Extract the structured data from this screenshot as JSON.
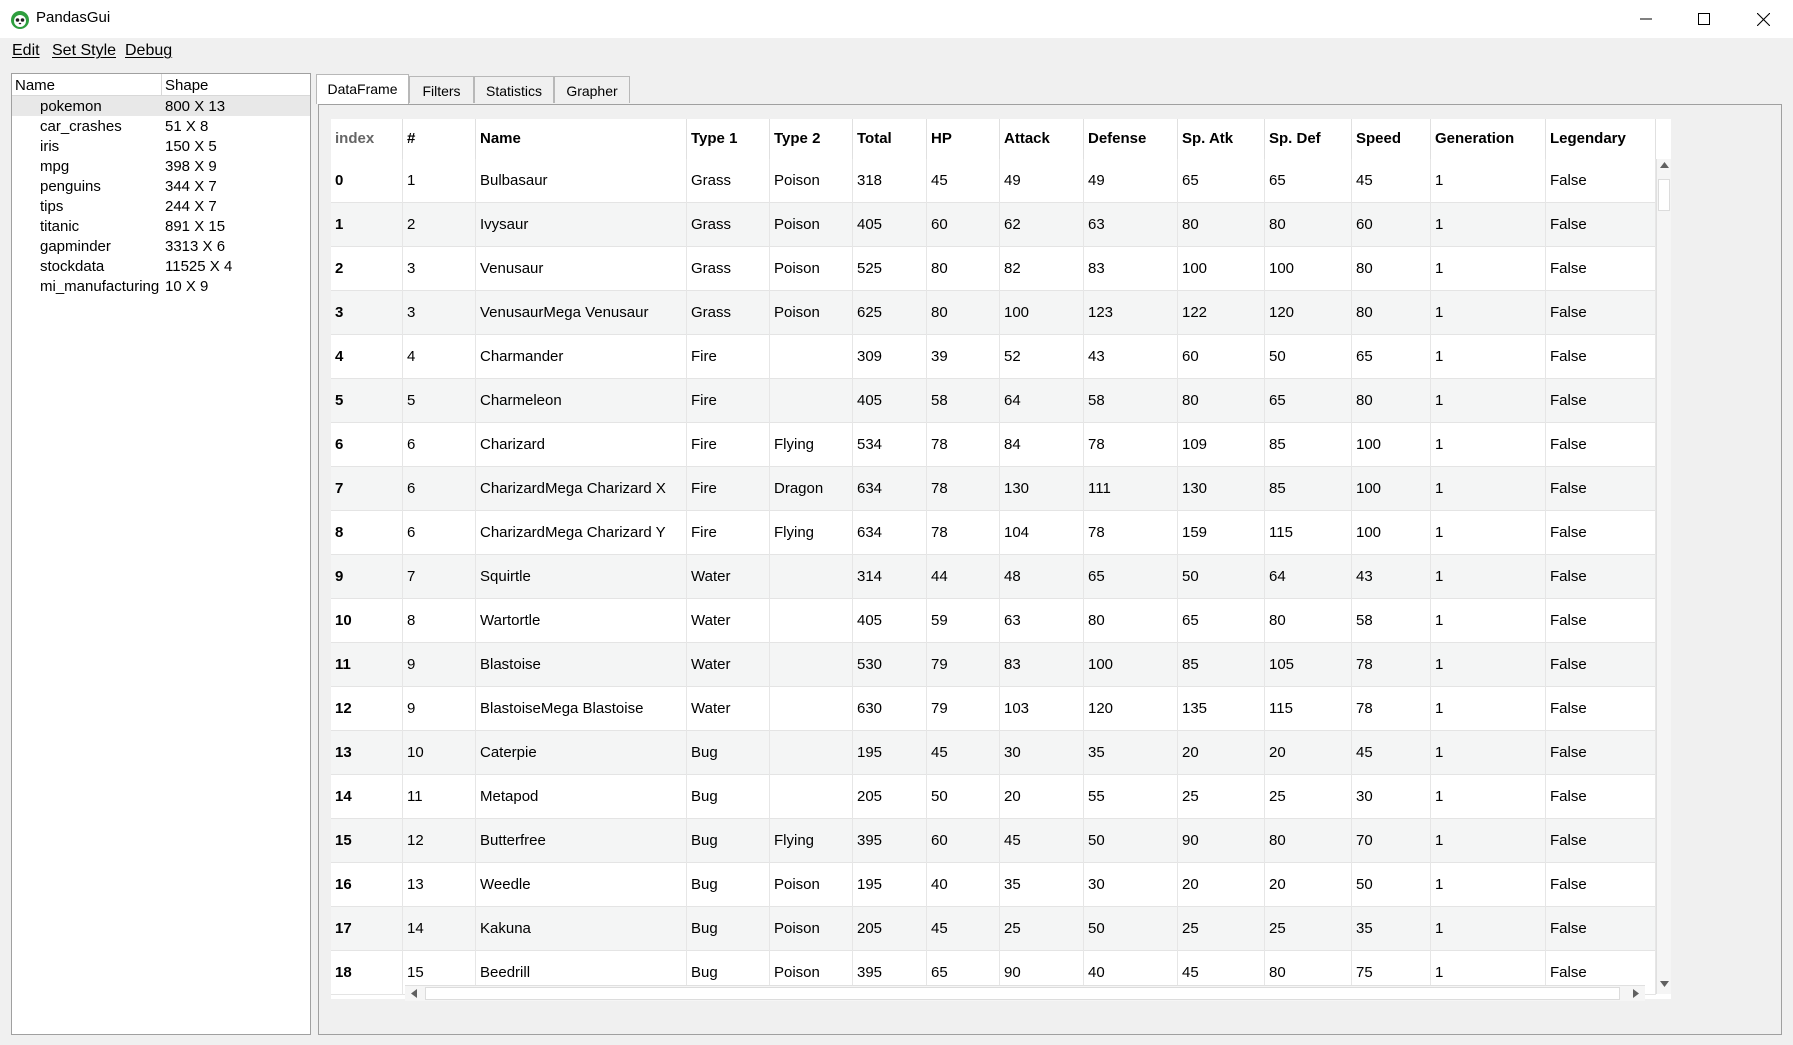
{
  "window": {
    "title": "PandasGui",
    "colors": {
      "titlebar": "#ffffff",
      "background": "#f0f0f0",
      "selected_row": "#e8e8e8",
      "alt_row": "#f4f5f5"
    }
  },
  "icons": {
    "app": "pandas-face-icon",
    "minimize": "minimize-icon",
    "maximize": "maximize-icon",
    "close": "close-icon"
  },
  "menu": {
    "edit": "Edit",
    "set_style": "Set Style",
    "debug": "Debug"
  },
  "dataframes": {
    "headers": {
      "name": "Name",
      "shape": "Shape"
    },
    "items": [
      {
        "name": "pokemon",
        "shape": "800 X 13",
        "selected": true
      },
      {
        "name": "car_crashes",
        "shape": "51 X 8"
      },
      {
        "name": "iris",
        "shape": "150 X 5"
      },
      {
        "name": "mpg",
        "shape": "398 X 9"
      },
      {
        "name": "penguins",
        "shape": "344 X 7"
      },
      {
        "name": "tips",
        "shape": "244 X 7"
      },
      {
        "name": "titanic",
        "shape": "891 X 15"
      },
      {
        "name": "gapminder",
        "shape": "3313 X 6"
      },
      {
        "name": "stockdata",
        "shape": "11525 X 4"
      },
      {
        "name": "mi_manufacturing",
        "shape": "10 X 9"
      }
    ]
  },
  "tabs": [
    {
      "label": "DataFrame",
      "active": true
    },
    {
      "label": "Filters"
    },
    {
      "label": "Statistics"
    },
    {
      "label": "Grapher"
    }
  ],
  "table": {
    "columns": [
      "index",
      "#",
      "Name",
      "Type 1",
      "Type 2",
      "Total",
      "HP",
      "Attack",
      "Defense",
      "Sp. Atk",
      "Sp. Def",
      "Speed",
      "Generation",
      "Legendary"
    ],
    "rows": [
      [
        "0",
        "1",
        "Bulbasaur",
        "Grass",
        "Poison",
        "318",
        "45",
        "49",
        "49",
        "65",
        "65",
        "45",
        "1",
        "False"
      ],
      [
        "1",
        "2",
        "Ivysaur",
        "Grass",
        "Poison",
        "405",
        "60",
        "62",
        "63",
        "80",
        "80",
        "60",
        "1",
        "False"
      ],
      [
        "2",
        "3",
        "Venusaur",
        "Grass",
        "Poison",
        "525",
        "80",
        "82",
        "83",
        "100",
        "100",
        "80",
        "1",
        "False"
      ],
      [
        "3",
        "3",
        "VenusaurMega Venusaur",
        "Grass",
        "Poison",
        "625",
        "80",
        "100",
        "123",
        "122",
        "120",
        "80",
        "1",
        "False"
      ],
      [
        "4",
        "4",
        "Charmander",
        "Fire",
        "",
        "309",
        "39",
        "52",
        "43",
        "60",
        "50",
        "65",
        "1",
        "False"
      ],
      [
        "5",
        "5",
        "Charmeleon",
        "Fire",
        "",
        "405",
        "58",
        "64",
        "58",
        "80",
        "65",
        "80",
        "1",
        "False"
      ],
      [
        "6",
        "6",
        "Charizard",
        "Fire",
        "Flying",
        "534",
        "78",
        "84",
        "78",
        "109",
        "85",
        "100",
        "1",
        "False"
      ],
      [
        "7",
        "6",
        "CharizardMega Charizard X",
        "Fire",
        "Dragon",
        "634",
        "78",
        "130",
        "111",
        "130",
        "85",
        "100",
        "1",
        "False"
      ],
      [
        "8",
        "6",
        "CharizardMega Charizard Y",
        "Fire",
        "Flying",
        "634",
        "78",
        "104",
        "78",
        "159",
        "115",
        "100",
        "1",
        "False"
      ],
      [
        "9",
        "7",
        "Squirtle",
        "Water",
        "",
        "314",
        "44",
        "48",
        "65",
        "50",
        "64",
        "43",
        "1",
        "False"
      ],
      [
        "10",
        "8",
        "Wartortle",
        "Water",
        "",
        "405",
        "59",
        "63",
        "80",
        "65",
        "80",
        "58",
        "1",
        "False"
      ],
      [
        "11",
        "9",
        "Blastoise",
        "Water",
        "",
        "530",
        "79",
        "83",
        "100",
        "85",
        "105",
        "78",
        "1",
        "False"
      ],
      [
        "12",
        "9",
        "BlastoiseMega Blastoise",
        "Water",
        "",
        "630",
        "79",
        "103",
        "120",
        "135",
        "115",
        "78",
        "1",
        "False"
      ],
      [
        "13",
        "10",
        "Caterpie",
        "Bug",
        "",
        "195",
        "45",
        "30",
        "35",
        "20",
        "20",
        "45",
        "1",
        "False"
      ],
      [
        "14",
        "11",
        "Metapod",
        "Bug",
        "",
        "205",
        "50",
        "20",
        "55",
        "25",
        "25",
        "30",
        "1",
        "False"
      ],
      [
        "15",
        "12",
        "Butterfree",
        "Bug",
        "Flying",
        "395",
        "60",
        "45",
        "50",
        "90",
        "80",
        "70",
        "1",
        "False"
      ],
      [
        "16",
        "13",
        "Weedle",
        "Bug",
        "Poison",
        "195",
        "40",
        "35",
        "30",
        "20",
        "20",
        "50",
        "1",
        "False"
      ],
      [
        "17",
        "14",
        "Kakuna",
        "Bug",
        "Poison",
        "205",
        "45",
        "25",
        "50",
        "25",
        "25",
        "35",
        "1",
        "False"
      ],
      [
        "18",
        "15",
        "Beedrill",
        "Bug",
        "Poison",
        "395",
        "65",
        "90",
        "40",
        "45",
        "80",
        "75",
        "1",
        "False"
      ]
    ]
  }
}
